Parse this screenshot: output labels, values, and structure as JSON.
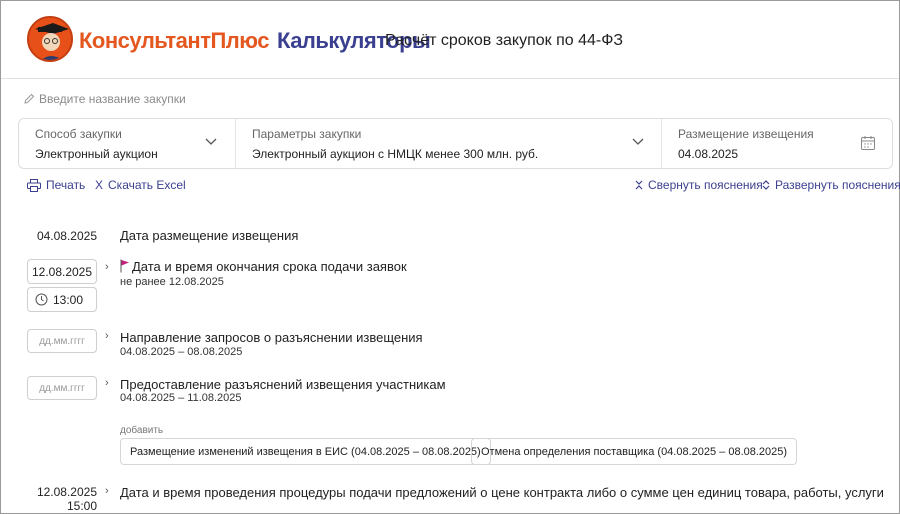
{
  "header": {
    "brand": "КонсультантПлюс",
    "calc": "Калькуляторы",
    "title": "Расчёт сроков закупок по 44-ФЗ"
  },
  "name_placeholder": "Введите название закупки",
  "params": {
    "method_label": "Способ закупки",
    "method_value": "Электронный аукцион",
    "params_label": "Параметры закупки",
    "params_value": "Электронный аукцион с НМЦК менее 300 млн. руб.",
    "placement_label": "Размещение извещения",
    "placement_value": "04.08.2025"
  },
  "actions": {
    "print": "Печать",
    "excel": "Скачать Excel",
    "collapse": "Свернуть пояснения",
    "expand": "Развернуть пояснения"
  },
  "timeline": {
    "item1": {
      "date": "04.08.2025",
      "title": "Дата размещение извещения"
    },
    "item2": {
      "date": "12.08.2025",
      "time": "13:00",
      "title": "Дата и время окончания срока подачи заявок",
      "sub": "не ранее 12.08.2025",
      "flag_color": "#c2227a"
    },
    "item3": {
      "placeholder": "дд.мм.гггг",
      "title": "Направление запросов о разъяснении извещения",
      "sub": "04.08.2025 – 08.08.2025"
    },
    "item4": {
      "placeholder": "дд.мм.гггг",
      "title": "Предоставление разъяснений извещения участникам",
      "sub": "04.08.2025 – 11.08.2025"
    },
    "add_label": "добавить",
    "chip1": "Размещение изменений извещения в ЕИС (04.08.2025 – 08.08.2025)",
    "chip2": "Отмена определения поставщика (04.08.2025 – 08.08.2025)",
    "item5": {
      "date": "12.08.2025",
      "time": "15:00",
      "title": "Дата и время проведения процедуры подачи предложений о цене контракта либо о сумме цен единиц товара, работы, услуги"
    }
  },
  "colors": {
    "brand": "#e4571f",
    "accent": "#3b3f8e"
  }
}
